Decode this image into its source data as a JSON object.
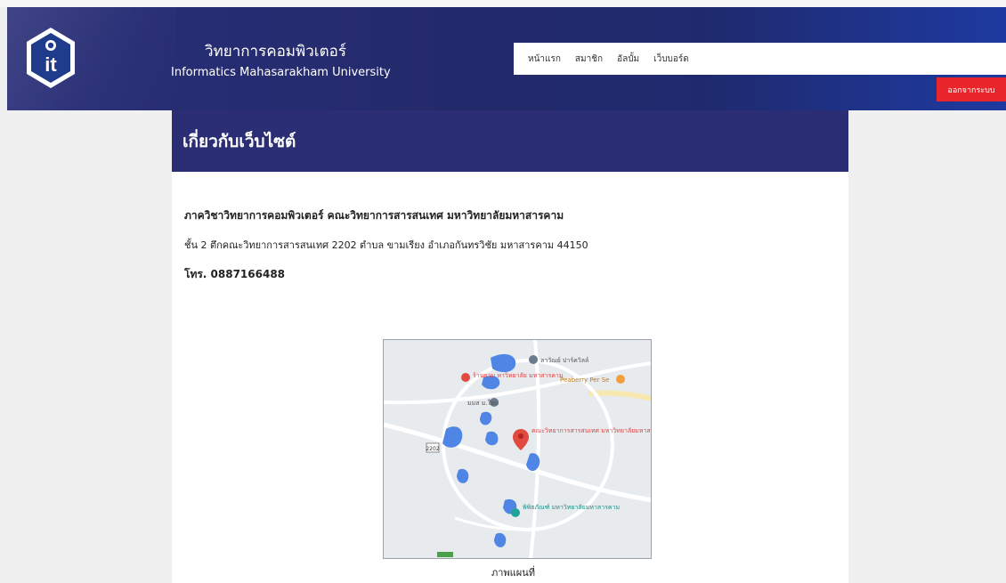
{
  "header": {
    "site_title": "วิทยาการคอมพิวเตอร์",
    "site_subtitle": "Informatics Mahasarakham University",
    "logo_text": "it"
  },
  "nav": {
    "items": [
      {
        "label": "หน้าแรก"
      },
      {
        "label": "สมาชิก"
      },
      {
        "label": "อัลบั้ม"
      },
      {
        "label": "เว็บบอร์ด"
      }
    ],
    "logout_label": "ออกจากระบบ"
  },
  "page": {
    "title": "เกี่ยวกับเว็บไซต์",
    "org_name": "ภาควิชาวิทยาการคอมพิวเตอร์ คณะวิทยาการสารสนเทศ มหาวิทยาลัยมหาสารคาม",
    "address": "ชั้น 2 ตึกคณะวิทยาการสารสนเทศ 2202 ตำบล ขามเรียง อำเภอกันทรวิชัย มหาสารคาม 44150",
    "phone": "โทร. 0887166488",
    "map_caption": "ภาพแผนที่"
  },
  "map": {
    "labels": {
      "place1": "ลาวัณย์ ปาร์ควิลล์",
      "place2": "ร้านยาม หาวิทยาลัย มหาสารคาม",
      "place3": "Peaberry Per Se",
      "place4": "มมส ม.ใหม่",
      "place5": "คณะวิทยาการสารสนเทศ มหาวิทยาลัยมหาสารคาม",
      "place6": "พิพิธภัณฑ์ มหาวิทยาลัยมหาสารคาม",
      "road": "2202"
    },
    "colors": {
      "water": "#4f86e6",
      "road": "#ffffff",
      "land": "#e8ebee",
      "marker_red": "#e04a3f",
      "marker_gray": "#6b7a8c",
      "marker_teal": "#1fa59a",
      "marker_orange": "#f2a03d"
    }
  }
}
